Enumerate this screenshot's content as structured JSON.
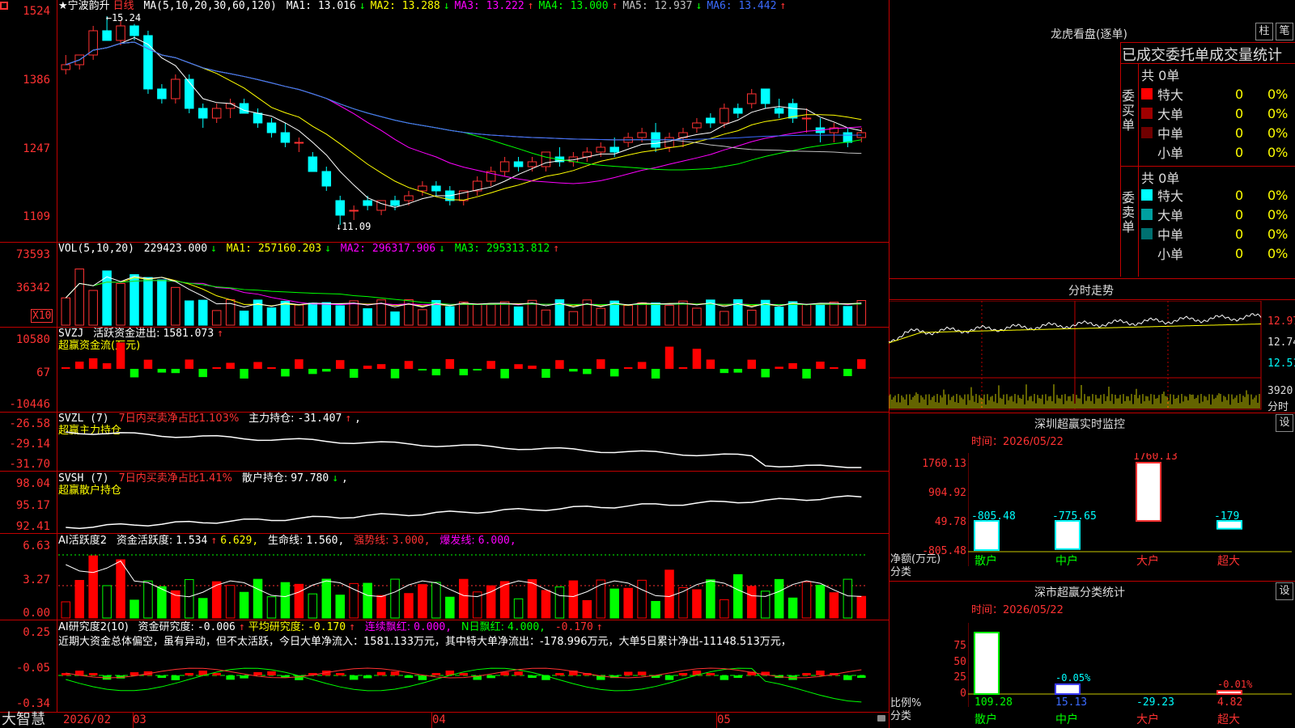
{
  "main_panel": {
    "stock_name": "★宁波韵升",
    "period": "日线",
    "ma_params": "MA(5,10,20,30,60,120)",
    "ma": [
      {
        "label": "MA1:",
        "value": "13.016",
        "arrow": "↓",
        "color": "#ffffff"
      },
      {
        "label": "MA2:",
        "value": "13.288",
        "arrow": "↓",
        "color": "#ffff00"
      },
      {
        "label": "MA3:",
        "value": "13.222",
        "arrow": "↑",
        "color": "#ff00ff"
      },
      {
        "label": "MA4:",
        "value": "13.000",
        "arrow": "↑",
        "color": "#00ff00"
      },
      {
        "label": "MA5:",
        "value": "12.937",
        "arrow": "↓",
        "color": "#c0c0c0"
      },
      {
        "label": "MA6:",
        "value": "13.442",
        "arrow": "↑",
        "color": "#3b6bff"
      }
    ],
    "y_labels": [
      "1524",
      "1386",
      "1247",
      "1109"
    ],
    "high_mark": "15.24",
    "low_mark": "11.09"
  },
  "vol_panel": {
    "title": "VOL(5,10,20)",
    "vol": "229423.000",
    "vol_arrow": "↓",
    "ma1": "MA1: 257160.203",
    "ma1_arrow": "↓",
    "ma2": "MA2: 296317.906",
    "ma2_arrow": "↓",
    "ma3": "MA3: 295313.812",
    "ma3_arrow": "↑",
    "y_labels": [
      "73593",
      "36342"
    ],
    "unit": "X10"
  },
  "svzj_panel": {
    "title": "SVZJ",
    "label": "活跃资金进出:",
    "value": "1581.073",
    "arrow": "↑",
    "subtitle": "超赢资金流(万元)",
    "y_labels": [
      "10580",
      "67",
      "-10446"
    ]
  },
  "svzl_panel": {
    "title": "SVZL (7)",
    "label": "7日内买卖净占比1.103%",
    "label2": "主力持仓:",
    "value": "-31.407",
    "arrow": "↑",
    "tail": ",",
    "subtitle": "超赢主力持仓",
    "y_labels": [
      "-26.58",
      "-29.14",
      "-31.70"
    ]
  },
  "svsh_panel": {
    "title": "SVSH (7)",
    "label": "7日内买卖净占比1.41%",
    "label2": "散户持仓:",
    "value": "97.780",
    "arrow": "↓",
    "tail": ",",
    "subtitle": "超赢散户持仓",
    "y_labels": [
      "98.04",
      "95.17",
      "92.41"
    ]
  },
  "ai_active_panel": {
    "title": "AI活跃度2",
    "label": "资金活跃度:",
    "value": "1.534",
    "arrow": "↑",
    "value2": "6.629,",
    "life_label": "生命线:",
    "life_value": "1.560,",
    "strong_label": "强势线:",
    "strong_value": "3.000,",
    "burst_label": "爆发线:",
    "burst_value": "6.000,",
    "y_labels": [
      "6.63",
      "3.27",
      "0.00"
    ]
  },
  "ai_research_panel": {
    "title": "AI研究度2(10)",
    "label": "资金研究度:",
    "value": "-0.006",
    "arrow": "↑",
    "avg_label": "平均研究度:",
    "avg_value": "-0.170",
    "avg_arrow": "↑",
    "red_label": "连续飘红:",
    "red_value": "0.000,",
    "nred_label": "N日飘红:",
    "nred_value": "4.000,",
    "last_value": "-0.170",
    "last_arrow": "↑",
    "comment": "近期大资金总体偏空，虽有异动，但不太活跃，今日大单净流入：1581.133万元，其中特大单净流出：-178.996万元，大单5日累计净出-11148.513万元，",
    "y_labels": [
      "0.25",
      "-0.05",
      "-0.34"
    ]
  },
  "bottom_bar": {
    "brand": "大智慧",
    "dates": [
      "2026/02",
      "03",
      "04",
      "05"
    ]
  },
  "right_panel": {
    "tabs": [
      "柱",
      "笔"
    ],
    "title": "龙虎看盘(逐单)",
    "table_title": "已成交委托单成交量统计",
    "buy_side": {
      "label": "委买单",
      "total": "共 0单",
      "rows": [
        {
          "name": "特大",
          "count": "0",
          "pct": "0%",
          "color": "#ff0000"
        },
        {
          "name": "大单",
          "count": "0",
          "pct": "0%",
          "color": "#a00000"
        },
        {
          "name": "中单",
          "count": "0",
          "pct": "0%",
          "color": "#700000"
        },
        {
          "name": "小单",
          "count": "0",
          "pct": "0%",
          "color": ""
        }
      ]
    },
    "sell_side": {
      "label": "委卖单",
      "total": "共 0单",
      "rows": [
        {
          "name": "特大",
          "count": "0",
          "pct": "0%",
          "color": "#00ffff"
        },
        {
          "name": "大单",
          "count": "0",
          "pct": "0%",
          "color": "#00a0a0"
        },
        {
          "name": "中单",
          "count": "0",
          "pct": "0%",
          "color": "#007070"
        },
        {
          "name": "小单",
          "count": "0",
          "pct": "0%",
          "color": ""
        }
      ]
    },
    "intraday": {
      "title": "分时走势",
      "price_labels": [
        "12.97",
        "12.74",
        "12.51"
      ],
      "vol_label": "3920",
      "vol_unit": "分时"
    },
    "sz_monitor": {
      "title": "深圳超赢实时监控",
      "settings": "设",
      "date_label": "时间：2026/05/22",
      "y_labels": [
        "1760.13",
        "904.92",
        "49.78",
        "-805.48"
      ],
      "axis_title": "净额(万元)",
      "axis_title2": "分类",
      "bars": [
        {
          "cat": "散户",
          "value": -805.48,
          "label": "-805.48"
        },
        {
          "cat": "中户",
          "value": -775.65,
          "label": "-775.65"
        },
        {
          "cat": "大户",
          "value": 1760.13,
          "label": "1760.13"
        },
        {
          "cat": "超大",
          "value": -179,
          "label": "-179"
        }
      ]
    },
    "sz_class": {
      "title": "深市超赢分类统计",
      "settings": "设",
      "date_label": "时间：2026/05/22",
      "y_labels": [
        "75",
        "50",
        "25",
        "0"
      ],
      "axis_title": "比例%",
      "axis_title2": "分类",
      "bars": [
        {
          "cat": "散户",
          "value": 109.28,
          "label": "109.28",
          "top": ""
        },
        {
          "cat": "中户",
          "value": 15.13,
          "label": "15.13",
          "top": "-0.05%"
        },
        {
          "cat": "大户",
          "value": -29.23,
          "label": "-29.23",
          "top": ""
        },
        {
          "cat": "超大",
          "value": 4.82,
          "label": "4.82",
          "top": "-0.01%"
        }
      ]
    }
  },
  "chart_data": {
    "type": "bar",
    "title": "宁波韵升 日线",
    "candles_ohlc": [
      [
        14.3,
        14.6,
        14.2,
        14.4
      ],
      [
        14.4,
        14.6,
        14.3,
        14.6
      ],
      [
        14.6,
        15.2,
        14.5,
        15.1
      ],
      [
        15.1,
        15.4,
        14.9,
        14.9
      ],
      [
        14.9,
        15.3,
        14.8,
        15.2
      ],
      [
        15.2,
        15.24,
        14.9,
        15.0
      ],
      [
        15.0,
        15.1,
        13.8,
        13.9
      ],
      [
        13.9,
        14.0,
        13.6,
        13.7
      ],
      [
        13.7,
        14.2,
        13.6,
        14.1
      ],
      [
        14.1,
        14.2,
        13.4,
        13.5
      ],
      [
        13.5,
        13.6,
        13.1,
        13.3
      ],
      [
        13.3,
        13.6,
        13.2,
        13.5
      ],
      [
        13.5,
        13.7,
        13.3,
        13.6
      ],
      [
        13.6,
        13.7,
        13.4,
        13.4
      ],
      [
        13.4,
        13.5,
        13.1,
        13.2
      ],
      [
        13.2,
        13.3,
        12.9,
        13.0
      ],
      [
        13.0,
        13.2,
        12.7,
        12.8
      ],
      [
        12.8,
        12.9,
        12.6,
        12.8
      ],
      [
        12.5,
        12.6,
        12.2,
        12.2
      ],
      [
        12.2,
        12.3,
        11.8,
        11.9
      ],
      [
        11.6,
        11.7,
        11.1,
        11.3
      ],
      [
        11.4,
        11.5,
        11.2,
        11.4
      ],
      [
        11.6,
        11.7,
        11.4,
        11.5
      ],
      [
        11.4,
        11.6,
        11.3,
        11.6
      ],
      [
        11.6,
        11.7,
        11.4,
        11.5
      ],
      [
        11.6,
        11.8,
        11.5,
        11.7
      ],
      [
        11.8,
        12.0,
        11.7,
        11.9
      ],
      [
        11.9,
        12.0,
        11.7,
        11.8
      ],
      [
        11.8,
        11.9,
        11.5,
        11.6
      ],
      [
        11.6,
        11.8,
        11.5,
        11.8
      ],
      [
        11.8,
        12.1,
        11.7,
        12.0
      ],
      [
        12.0,
        12.3,
        11.9,
        12.2
      ],
      [
        12.2,
        12.5,
        12.1,
        12.4
      ],
      [
        12.4,
        12.5,
        12.2,
        12.3
      ],
      [
        12.3,
        12.5,
        12.2,
        12.4
      ],
      [
        12.3,
        12.6,
        12.2,
        12.6
      ],
      [
        12.5,
        12.7,
        12.3,
        12.4
      ],
      [
        12.4,
        12.6,
        12.3,
        12.5
      ],
      [
        12.5,
        12.7,
        12.4,
        12.6
      ],
      [
        12.6,
        12.8,
        12.5,
        12.7
      ],
      [
        12.7,
        12.9,
        12.5,
        12.6
      ],
      [
        12.8,
        13.0,
        12.7,
        12.9
      ],
      [
        12.9,
        13.1,
        12.8,
        13.0
      ],
      [
        13.0,
        13.2,
        12.6,
        12.7
      ],
      [
        12.7,
        13.0,
        12.6,
        12.9
      ],
      [
        12.9,
        13.1,
        12.7,
        13.0
      ],
      [
        13.1,
        13.3,
        13.0,
        13.2
      ],
      [
        13.3,
        13.4,
        13.1,
        13.2
      ],
      [
        13.2,
        13.6,
        13.1,
        13.5
      ],
      [
        13.5,
        13.6,
        13.3,
        13.4
      ],
      [
        13.6,
        13.9,
        13.5,
        13.8
      ],
      [
        13.9,
        13.9,
        13.5,
        13.6
      ],
      [
        13.5,
        13.7,
        13.3,
        13.4
      ],
      [
        13.6,
        13.7,
        13.2,
        13.3
      ],
      [
        13.3,
        13.5,
        13.0,
        13.3
      ],
      [
        13.1,
        13.3,
        12.8,
        13.0
      ],
      [
        13.0,
        13.2,
        12.8,
        13.1
      ],
      [
        13.0,
        13.1,
        12.7,
        12.8
      ],
      [
        12.9,
        13.1,
        12.8,
        13.0
      ]
    ]
  }
}
